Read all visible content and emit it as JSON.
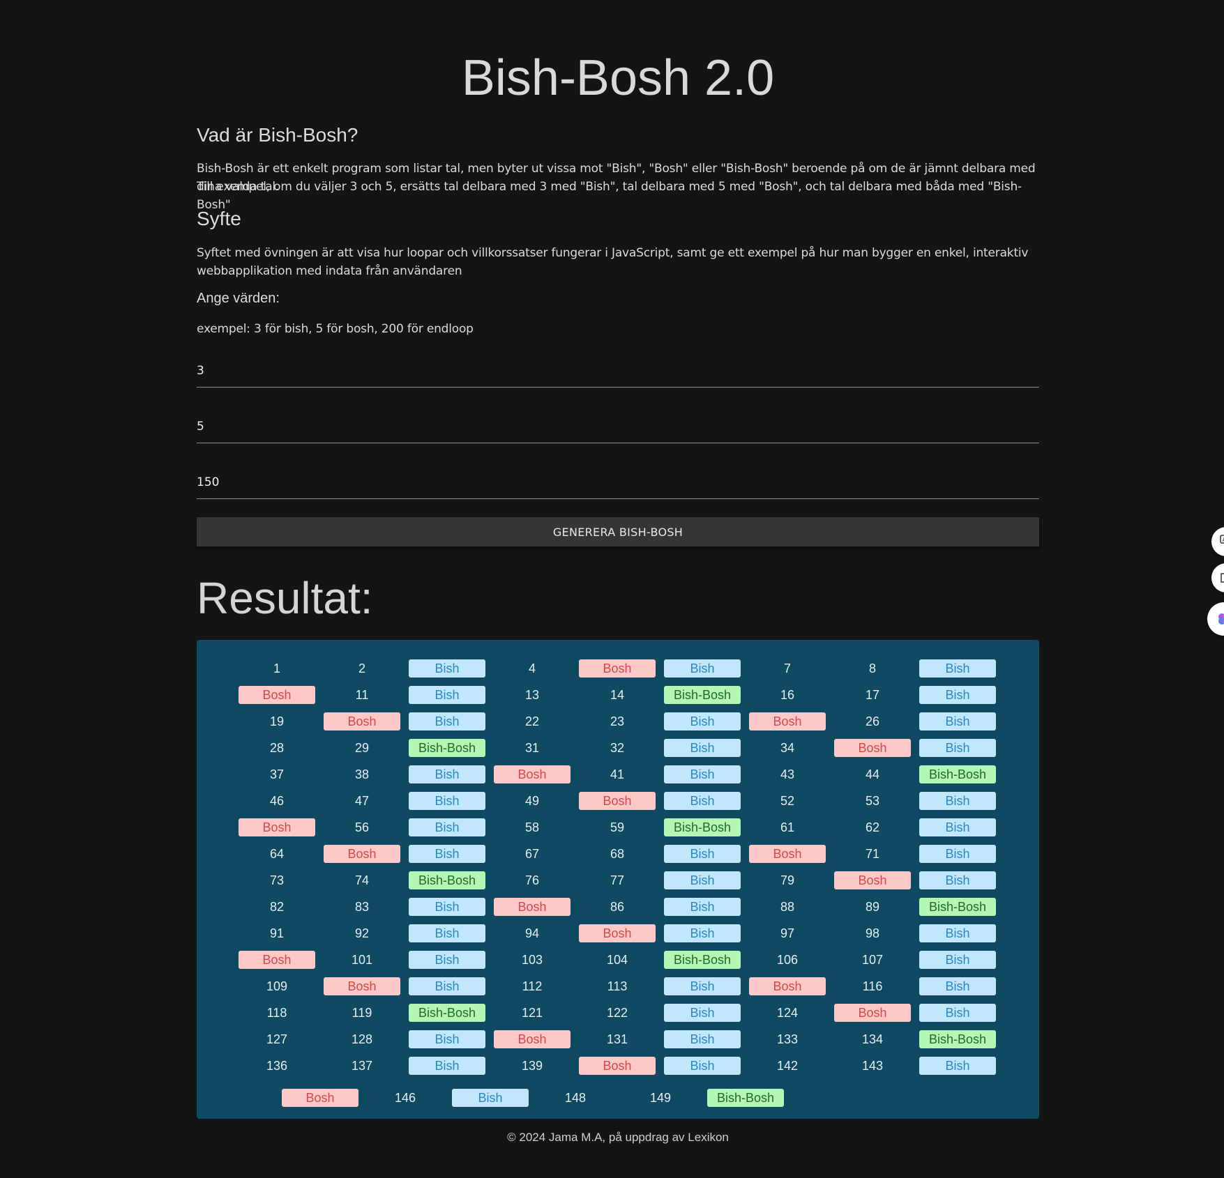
{
  "title": "Bish-Bosh 2.0",
  "about": {
    "heading": "Vad är Bish-Bosh?",
    "text1": "Bish-Bosh är ett enkelt program som listar tal, men byter ut vissa mot \"Bish\", \"Bosh\" eller \"Bish-Bosh\" beroende på om de är jämnt delbara med dina valda tal.",
    "text2": "Till exempel, om du väljer 3 och 5, ersätts tal delbara med 3 med \"Bish\", tal delbara med 5 med \"Bosh\", och tal delbara med båda med \"Bish-Bosh\""
  },
  "purpose": {
    "heading": "Syfte",
    "text1": "Syftet med övningen är att visa hur loopar och villkorssatser fungerar i JavaScript, samt ge ett exempel på hur man bygger en enkel, interaktiv",
    "text2": "webbapplikation med indata från användaren"
  },
  "form": {
    "heading": "Ange värden:",
    "hint": "exempel: 3 för bish, 5 för bosh, 200 för endloop",
    "bish_value": "3",
    "bosh_value": "5",
    "end_value": "150",
    "button_label": "GENERERA BISH-BOSH"
  },
  "results": {
    "heading": "Resultat:",
    "items": [
      "1",
      "2",
      "Bish",
      "4",
      "Bosh",
      "Bish",
      "7",
      "8",
      "Bish",
      "Bosh",
      "11",
      "Bish",
      "13",
      "14",
      "Bish-Bosh",
      "16",
      "17",
      "Bish",
      "19",
      "Bosh",
      "Bish",
      "22",
      "23",
      "Bish",
      "Bosh",
      "26",
      "Bish",
      "28",
      "29",
      "Bish-Bosh",
      "31",
      "32",
      "Bish",
      "34",
      "Bosh",
      "Bish",
      "37",
      "38",
      "Bish",
      "Bosh",
      "41",
      "Bish",
      "43",
      "44",
      "Bish-Bosh",
      "46",
      "47",
      "Bish",
      "49",
      "Bosh",
      "Bish",
      "52",
      "53",
      "Bish",
      "Bosh",
      "56",
      "Bish",
      "58",
      "59",
      "Bish-Bosh",
      "61",
      "62",
      "Bish",
      "64",
      "Bosh",
      "Bish",
      "67",
      "68",
      "Bish",
      "Bosh",
      "71",
      "Bish",
      "73",
      "74",
      "Bish-Bosh",
      "76",
      "77",
      "Bish",
      "79",
      "Bosh",
      "Bish",
      "82",
      "83",
      "Bish",
      "Bosh",
      "86",
      "Bish",
      "88",
      "89",
      "Bish-Bosh",
      "91",
      "92",
      "Bish",
      "94",
      "Bosh",
      "Bish",
      "97",
      "98",
      "Bish",
      "Bosh",
      "101",
      "Bish",
      "103",
      "104",
      "Bish-Bosh",
      "106",
      "107",
      "Bish",
      "109",
      "Bosh",
      "Bish",
      "112",
      "113",
      "Bish",
      "Bosh",
      "116",
      "Bish",
      "118",
      "119",
      "Bish-Bosh",
      "121",
      "122",
      "Bish",
      "124",
      "Bosh",
      "Bish",
      "127",
      "128",
      "Bish",
      "Bosh",
      "131",
      "Bish",
      "133",
      "134",
      "Bish-Bosh",
      "136",
      "137",
      "Bish",
      "139",
      "Bosh",
      "Bish",
      "142",
      "143",
      "Bish"
    ],
    "last_row": [
      "Bosh",
      "146",
      "Bish",
      "148",
      "149",
      "Bish-Bosh"
    ]
  },
  "footer": "© 2024 Jama M.A, på uppdrag av Lexikon",
  "colors": {
    "background": "#141414",
    "results_panel": "#0f4a62",
    "bish_bg": "#c0e7fb",
    "bosh_bg": "#fdc8c8",
    "bishbosh_bg": "#b4f6b4"
  },
  "side_icons": [
    "translate-icon",
    "reader-icon",
    "brain-icon"
  ]
}
